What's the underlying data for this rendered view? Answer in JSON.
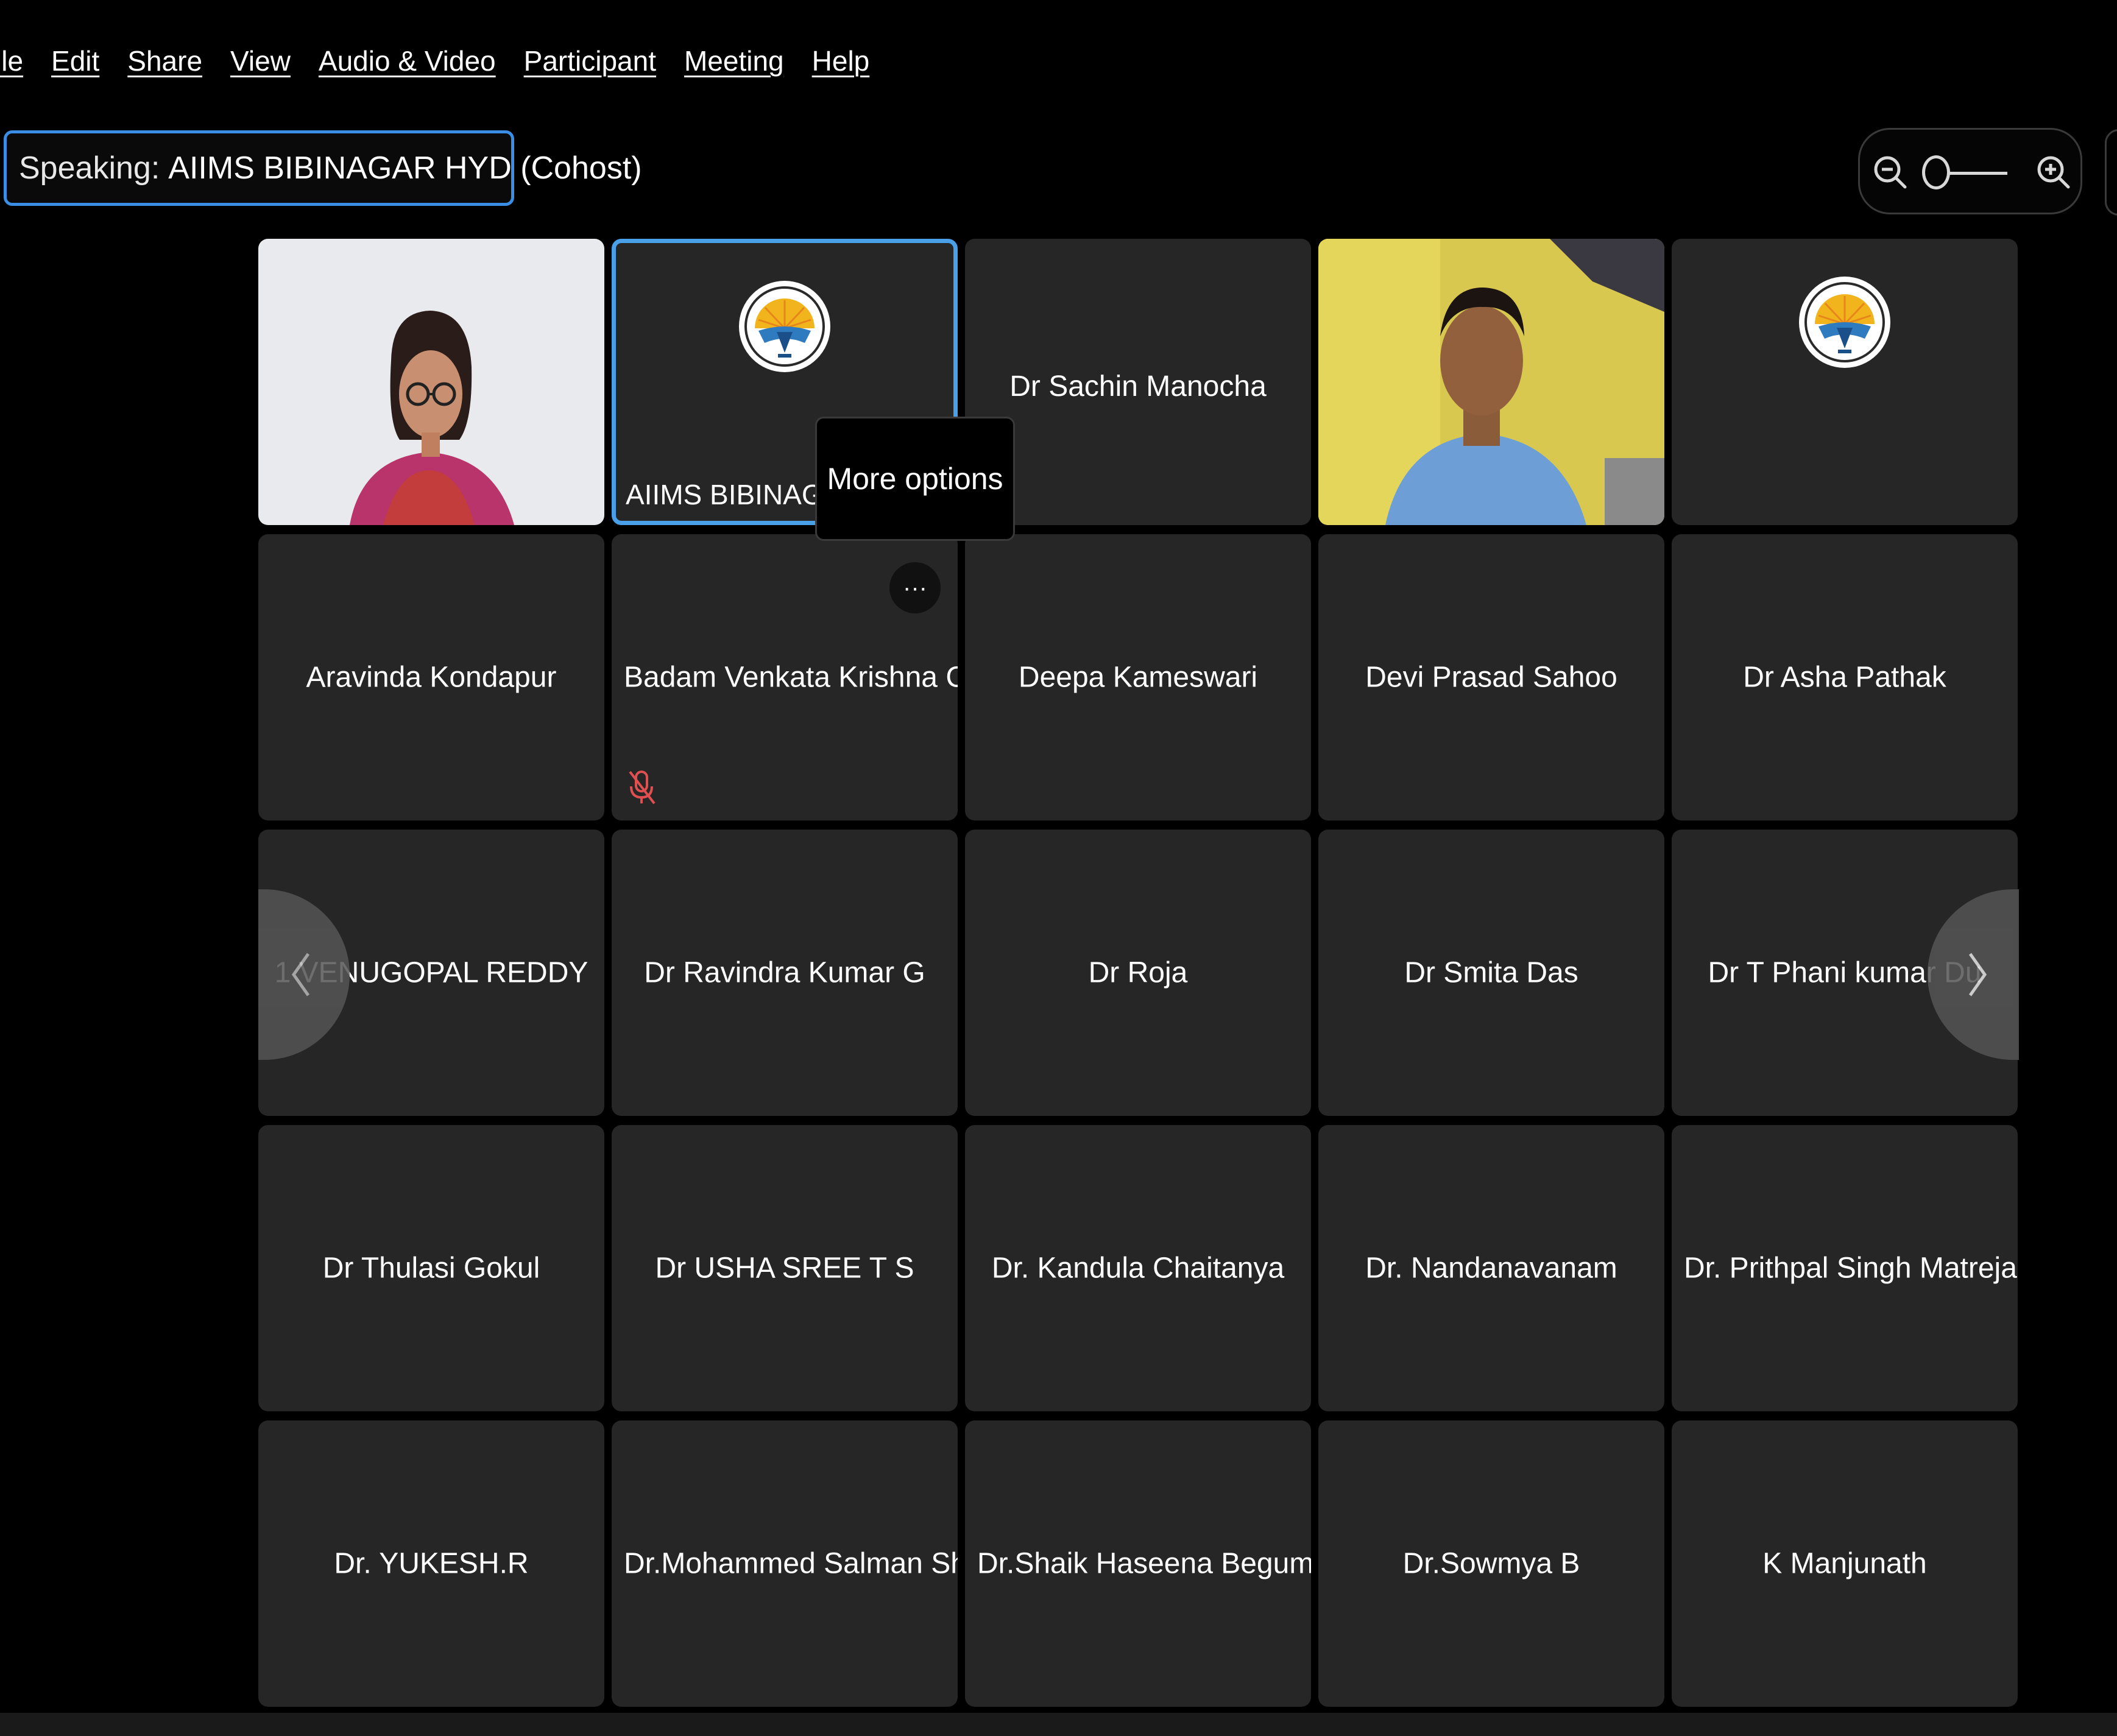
{
  "menu": {
    "items": [
      "ile",
      "Edit",
      "Share",
      "View",
      "Audio & Video",
      "Participant",
      "Meeting",
      "Help"
    ]
  },
  "speaking": {
    "prefix": "Speaking:",
    "name": "AIIMS BIBINAGAR HYD (Cohost)"
  },
  "zoom": {
    "out_icon": "zoom-out-icon",
    "in_icon": "zoom-in-icon",
    "level": 0
  },
  "tooltip": {
    "text": "More options"
  },
  "more_button": {
    "label": "···"
  },
  "tiles": [
    {
      "name": "",
      "kind": "video-woman"
    },
    {
      "name": "AIIMS BIBINAGAR I",
      "kind": "logo",
      "active": true
    },
    {
      "name": "Dr Sachin Manocha",
      "kind": "name-top"
    },
    {
      "name": "",
      "kind": "video-man"
    },
    {
      "name": "",
      "kind": "logo"
    },
    {
      "name": "Aravinda Kondapur"
    },
    {
      "name": "Badam Venkata Krishna Chai...",
      "muted": true,
      "hover": true
    },
    {
      "name": "Deepa Kameswari"
    },
    {
      "name": "Devi Prasad Sahoo"
    },
    {
      "name": "Dr Asha Pathak"
    },
    {
      "name": "1 VENUGOPAL REDDY"
    },
    {
      "name": "Dr Ravindra Kumar G"
    },
    {
      "name": "Dr Roja"
    },
    {
      "name": "Dr Smita Das"
    },
    {
      "name": "Dr T Phani kumar Du"
    },
    {
      "name": "Dr Thulasi Gokul"
    },
    {
      "name": "Dr USHA SREE T S"
    },
    {
      "name": "Dr. Kandula Chaitanya"
    },
    {
      "name": "Dr. Nandanavanam"
    },
    {
      "name": "Dr. Prithpal Singh Matreja"
    },
    {
      "name": "Dr. YUKESH.R"
    },
    {
      "name": "Dr.Mohammed Salman Sha..."
    },
    {
      "name": "Dr.Shaik Haseena Begum"
    },
    {
      "name": "Dr.Sowmya B"
    },
    {
      "name": "K Manjunath"
    }
  ],
  "nav": {
    "prev_icon": "chevron-left-icon",
    "next_icon": "chevron-right-icon"
  },
  "colors": {
    "accent_border": "#4aa0e8",
    "tile_bg": "#262626",
    "mute_red": "#e05050"
  }
}
